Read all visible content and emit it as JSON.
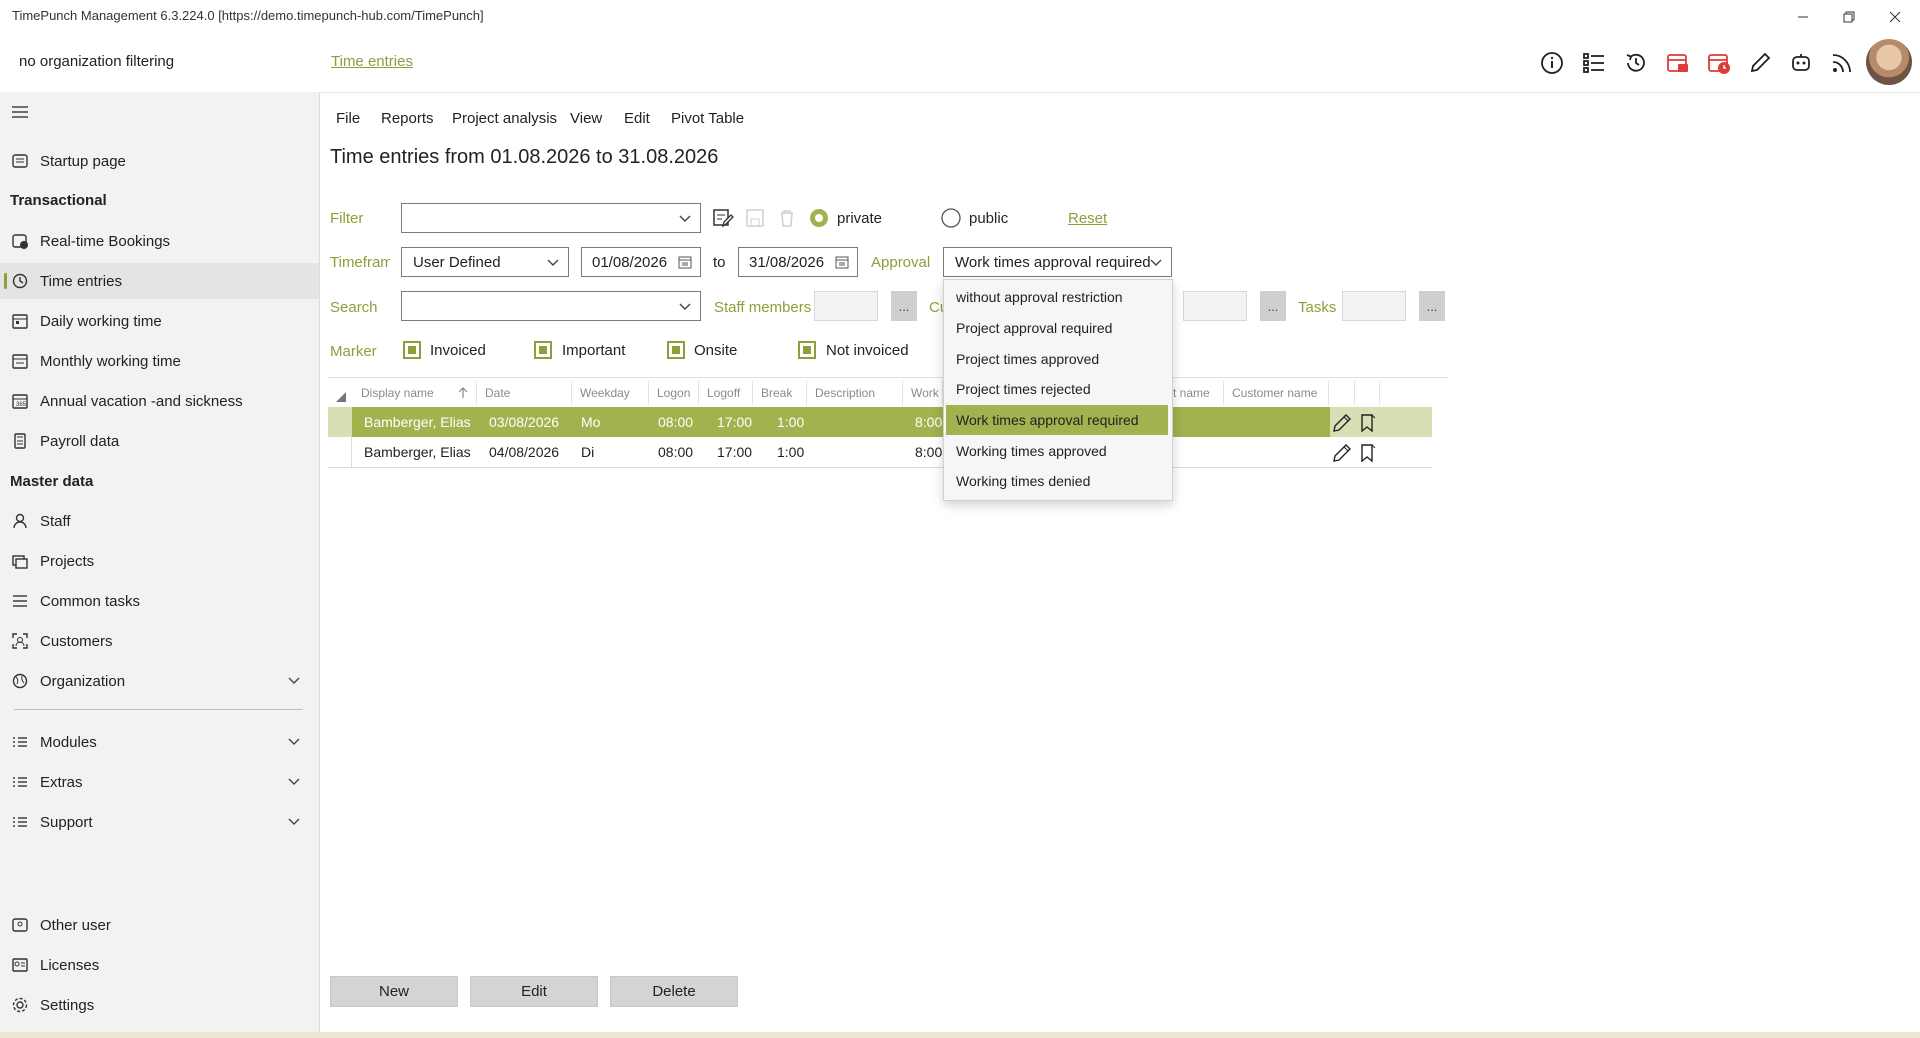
{
  "window": {
    "title": "TimePunch Management 6.3.224.0 [https://demo.timepunch-hub.com/TimePunch]"
  },
  "header": {
    "org_filter": "no organization filtering",
    "breadcrumb": "Time entries"
  },
  "sidebar": {
    "startup": "Startup page",
    "section_transactional": "Transactional",
    "transactional": [
      "Real-time Bookings",
      "Time entries",
      "Daily working time",
      "Monthly working time",
      "Annual vacation -and sickness",
      "Payroll data"
    ],
    "section_master": "Master data",
    "master": [
      "Staff",
      "Projects",
      "Common tasks",
      "Customers",
      "Organization"
    ],
    "groups": [
      "Modules",
      "Extras",
      "Support"
    ],
    "bottom": [
      "Other user",
      "Licenses",
      "Settings"
    ]
  },
  "menu": [
    "File",
    "Reports",
    "Project analysis",
    "View",
    "Edit",
    "Pivot Table"
  ],
  "page_title": "Time entries from 01.08.2026 to 31.08.2026",
  "filter": {
    "label": "Filter",
    "private": "private",
    "public": "public",
    "reset": "Reset",
    "timeframe_label": "Timeframe",
    "timeframe_value": "User Defined",
    "date_from": "01/08/2026",
    "to": "to",
    "date_to": "31/08/2026",
    "approval_label": "Approval",
    "approval_value": "Work times approval required",
    "search_label": "Search",
    "staff_label": "Staff members",
    "customers_partial": "Cu",
    "tasks_label": "Tasks",
    "dots": "...",
    "marker_label": "Marker",
    "markers": [
      "Invoiced",
      "Important",
      "Onsite",
      "Not invoiced"
    ]
  },
  "table": {
    "columns": [
      "Display name",
      "Date",
      "Weekday",
      "Logon",
      "Logoff",
      "Break",
      "Description",
      "Work",
      "t name",
      "Customer name"
    ],
    "rows": [
      {
        "name": "Bamberger, Elias",
        "date": "03/08/2026",
        "weekday": "Mo",
        "logon": "08:00",
        "logoff": "17:00",
        "break": "1:00",
        "work": "8:00"
      },
      {
        "name": "Bamberger, Elias",
        "date": "04/08/2026",
        "weekday": "Di",
        "logon": "08:00",
        "logoff": "17:00",
        "break": "1:00",
        "work": "8:00"
      }
    ]
  },
  "dropdown": {
    "options": [
      "without approval restriction",
      "Project approval required",
      "Project times approved",
      "Project times rejected",
      "Work times approval required",
      "Working times approved",
      "Working times denied"
    ],
    "selected_index": 4
  },
  "buttons": {
    "new": "New",
    "edit": "Edit",
    "delete": "Delete"
  },
  "colors": {
    "accent": "#a2b24f",
    "label_green": "#8aa03a",
    "red_icon": "#e03a3a"
  },
  "icons": [
    "info-icon",
    "list-icon",
    "history-icon",
    "calendar-briefcase-icon",
    "calendar-clock-icon",
    "pencil-icon",
    "robot-icon",
    "rss-icon",
    "avatar"
  ]
}
